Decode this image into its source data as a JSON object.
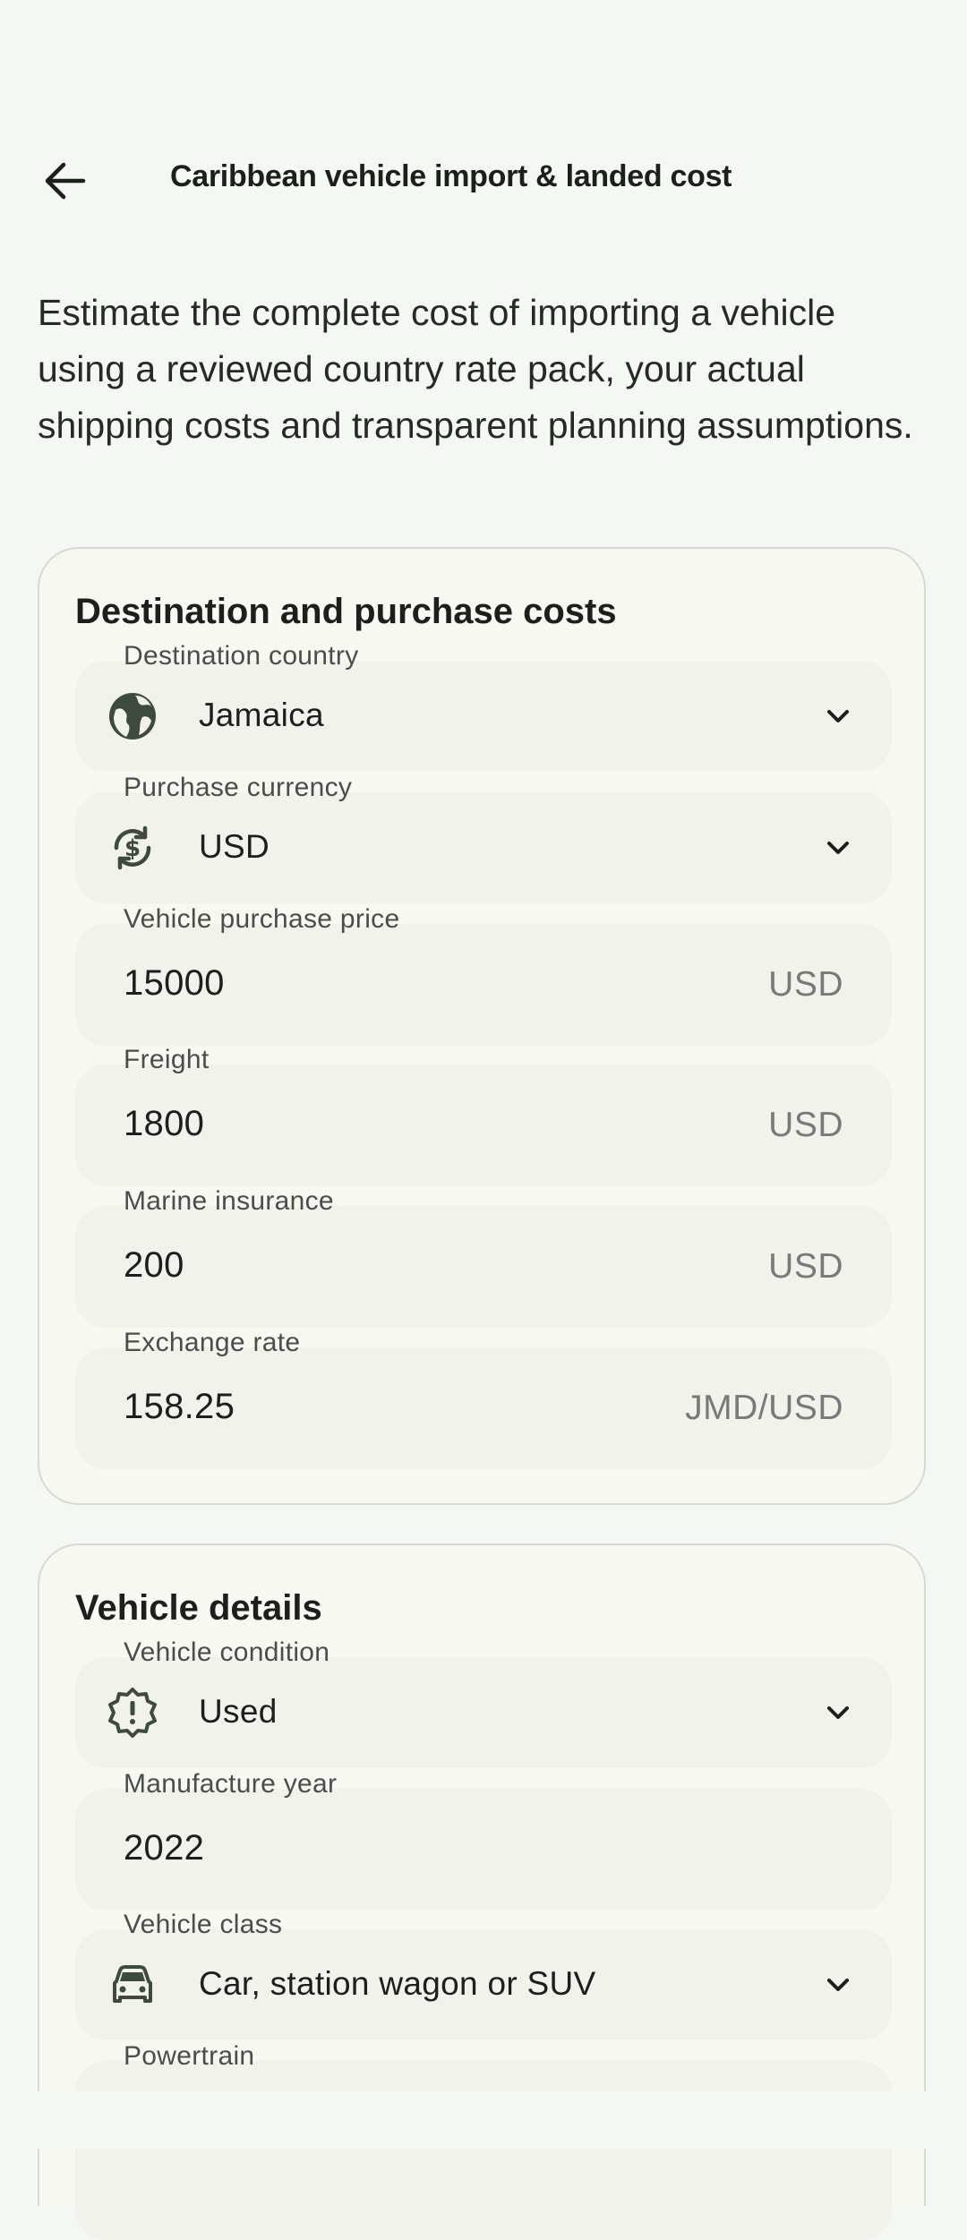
{
  "app_bar": {
    "title": "Caribbean vehicle import & landed cost",
    "back_icon": "arrow-back-icon"
  },
  "intro": "Estimate the complete cost of importing a vehicle using a reviewed country rate pack, your actual shipping costs and transparent planning assumptions.",
  "destination_card": {
    "title": "Destination and purchase costs",
    "destination_country": {
      "label": "Destination country",
      "value": "Jamaica",
      "icon": "globe-icon"
    },
    "purchase_currency": {
      "label": "Purchase currency",
      "value": "USD",
      "icon": "currency-exchange-icon"
    },
    "purchase_price": {
      "label": "Vehicle purchase price",
      "value": "15000",
      "suffix": "USD"
    },
    "freight": {
      "label": "Freight",
      "value": "1800",
      "suffix": "USD"
    },
    "marine_insurance": {
      "label": "Marine insurance",
      "value": "200",
      "suffix": "USD"
    },
    "exchange_rate": {
      "label": "Exchange rate",
      "value": "158.25",
      "suffix": "JMD/USD"
    }
  },
  "vehicle_card": {
    "title": "Vehicle details",
    "condition": {
      "label": "Vehicle condition",
      "value": "Used",
      "icon": "new-releases-icon"
    },
    "manufacture_year": {
      "label": "Manufacture year",
      "value": "2022"
    },
    "vehicle_class": {
      "label": "Vehicle class",
      "value": "Car, station wagon or SUV",
      "icon": "car-icon"
    },
    "powertrain": {
      "label": "Powertrain"
    }
  },
  "colors": {
    "background": "#f5f7f4",
    "card": "#f6f8f1",
    "field": "#f0f2eb",
    "icon": "#3f4a3e"
  }
}
